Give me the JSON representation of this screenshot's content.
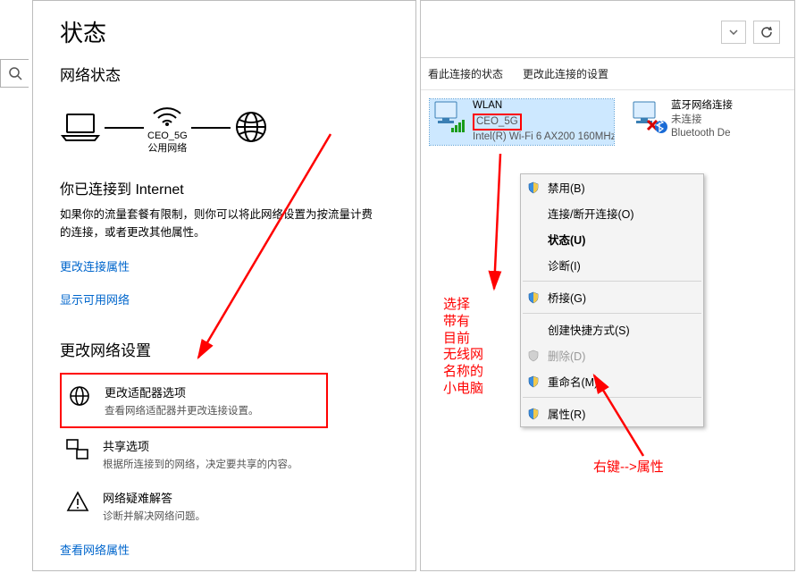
{
  "left": {
    "title": "状态",
    "subtitle": "网络状态",
    "wifi_name": "CEO_5G",
    "wifi_type": "公用网络",
    "connected_label": "你已连接到 Internet",
    "connected_desc": "如果你的流量套餐有限制，则你可以将此网络设置为按流量计费的连接，或者更改其他属性。",
    "link_change_conn": "更改连接属性",
    "link_show_available": "显示可用网络",
    "section_change": "更改网络设置",
    "options": [
      {
        "title": "更改适配器选项",
        "desc": "查看网络适配器并更改连接设置。"
      },
      {
        "title": "共享选项",
        "desc": "根据所连接到的网络，决定要共享的内容。"
      },
      {
        "title": "网络疑难解答",
        "desc": "诊断并解决网络问题。"
      }
    ],
    "link_view_props": "查看网络属性"
  },
  "right": {
    "toolbar_status": "看此连接的状态",
    "toolbar_change": "更改此连接的设置",
    "wlan_adapter_name": "WLAN",
    "wlan_ssid": "CEO_5G",
    "wlan_device": "Intel(R) Wi-Fi 6 AX200 160MHz",
    "bt_adapter_name": "蓝牙网络连接",
    "bt_status": "未连接",
    "bt_device": "Bluetooth De"
  },
  "ctx": {
    "disable": "禁用(B)",
    "connect": "连接/断开连接(O)",
    "status": "状态(U)",
    "diagnose": "诊断(I)",
    "bridge": "桥接(G)",
    "shortcut": "创建快捷方式(S)",
    "delete": "删除(D)",
    "rename": "重命名(M)",
    "properties": "属性(R)"
  },
  "ann": {
    "guide": "选择\n带有\n目前\n无线网\n名称的\n小电脑",
    "rightclick": "右键-->属性"
  }
}
